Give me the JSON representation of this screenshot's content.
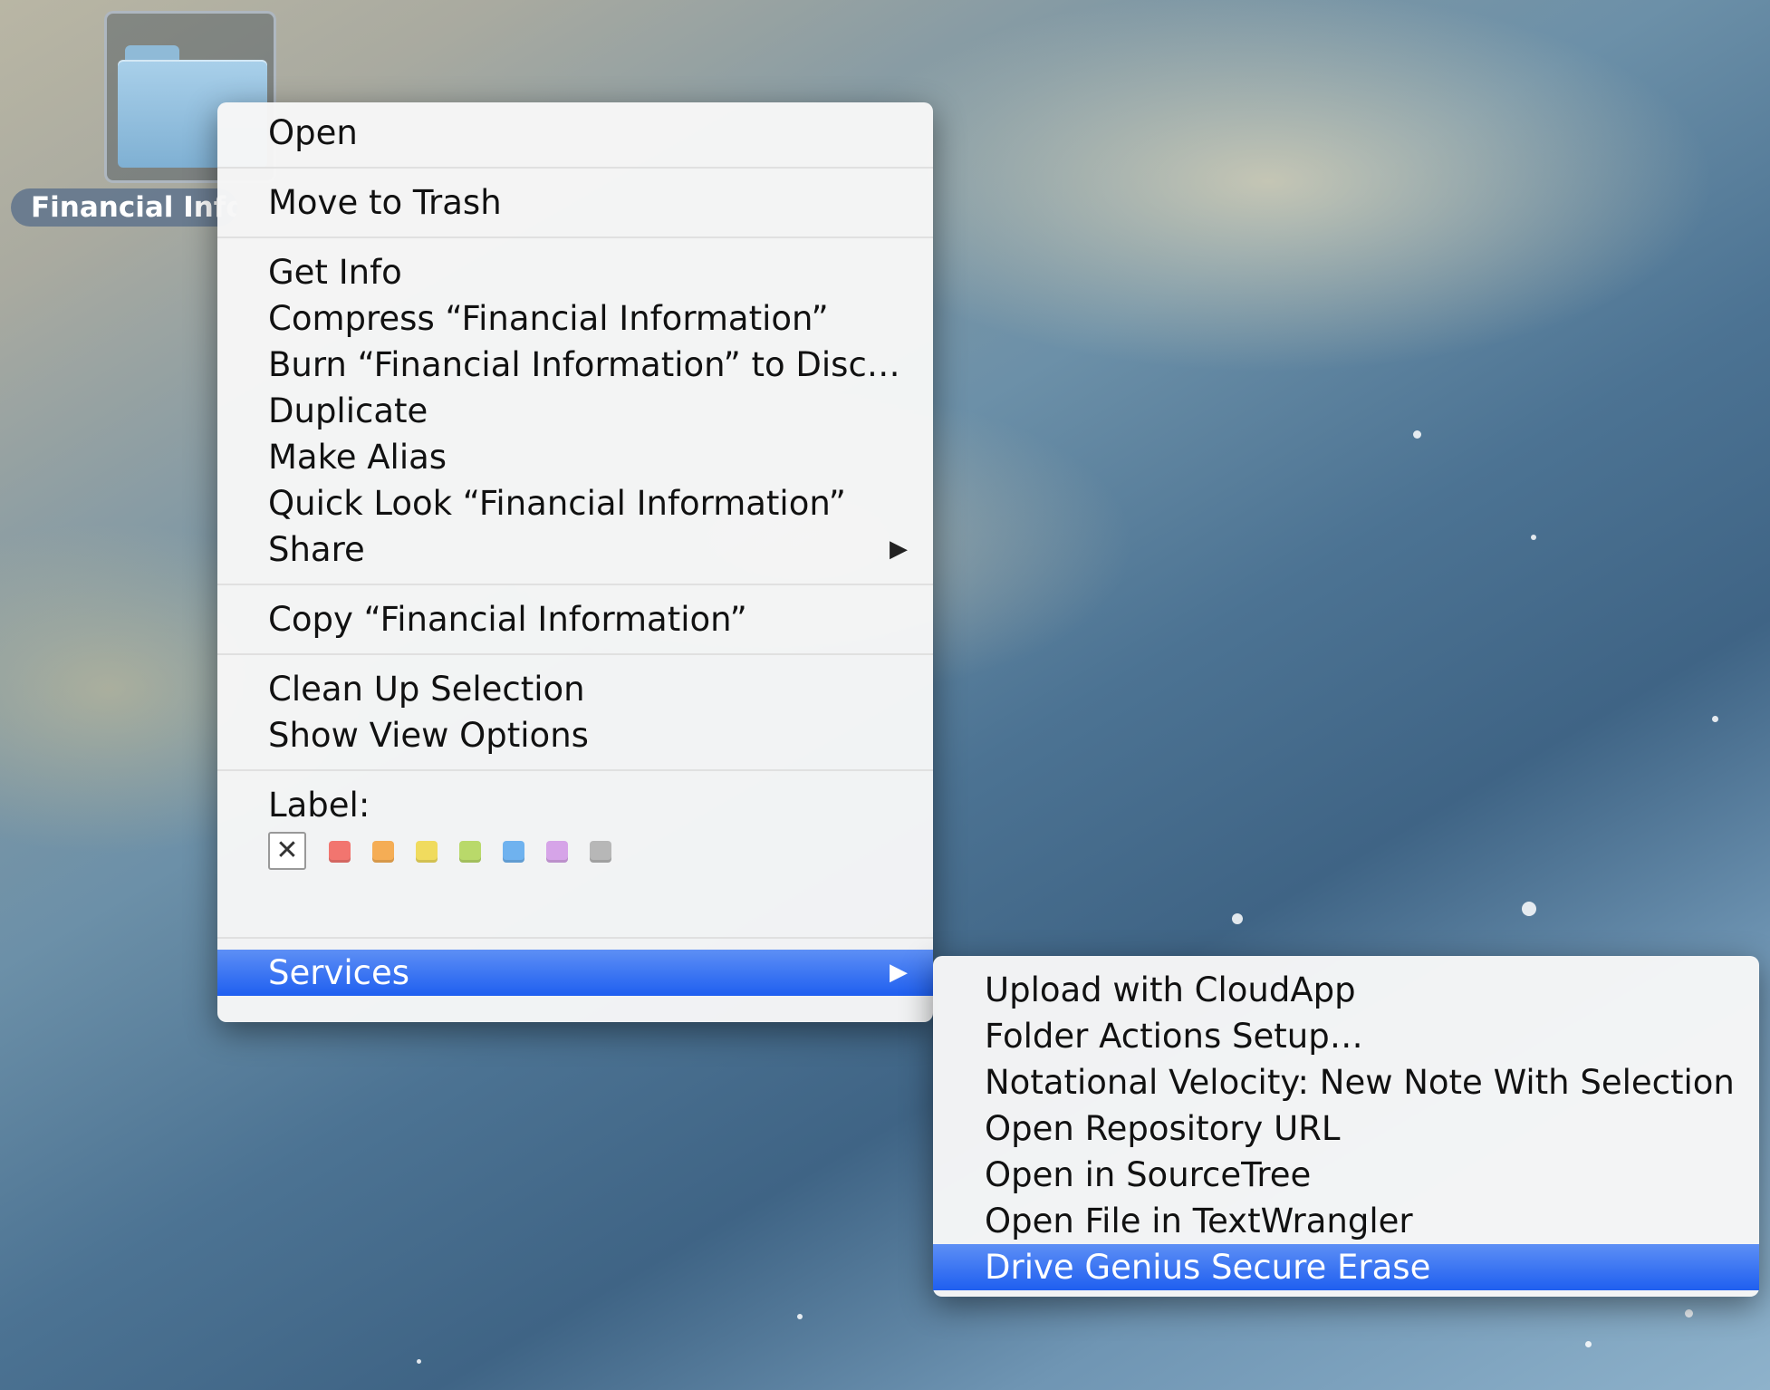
{
  "desktop": {
    "folder": {
      "label": "Financial Information"
    }
  },
  "context_menu": {
    "groups": [
      [
        {
          "label": "Open"
        }
      ],
      [
        {
          "label": "Move to Trash"
        }
      ],
      [
        {
          "label": "Get Info"
        },
        {
          "label": "Compress “Financial Information”"
        },
        {
          "label": "Burn “Financial Information” to Disc…"
        },
        {
          "label": "Duplicate"
        },
        {
          "label": "Make Alias"
        },
        {
          "label": "Quick Look “Financial Information”"
        },
        {
          "label": "Share",
          "submenu": true
        }
      ],
      [
        {
          "label": "Copy “Financial Information”"
        }
      ],
      [
        {
          "label": "Clean Up Selection"
        },
        {
          "label": "Show View Options"
        }
      ]
    ],
    "label_section": {
      "title": "Label:",
      "clear_glyph": "✕",
      "colors": [
        "#f2756f",
        "#f5ad55",
        "#f0db5e",
        "#b9d96a",
        "#6fb2ef",
        "#d6a4e8",
        "#b7b7b7"
      ]
    },
    "services": {
      "label": "Services",
      "highlighted": true
    },
    "highlight_color": "#2b68f0"
  },
  "services_menu": {
    "items": [
      {
        "label": "Upload with CloudApp"
      },
      {
        "label": "Folder Actions Setup…"
      },
      {
        "label": "Notational Velocity: New Note With Selection"
      },
      {
        "label": "Open Repository URL"
      },
      {
        "label": "Open in SourceTree"
      },
      {
        "label": "Open File in TextWrangler"
      },
      {
        "label": "Drive Genius Secure Erase",
        "highlighted": true
      }
    ]
  }
}
